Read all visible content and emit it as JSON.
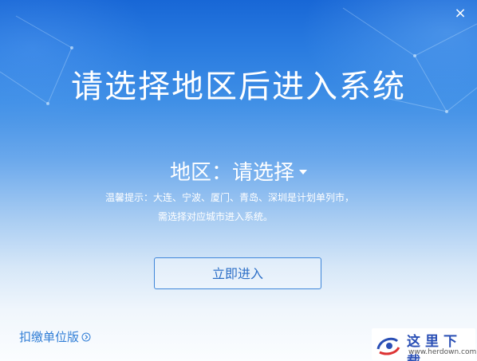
{
  "window": {
    "close_label": "×"
  },
  "main": {
    "title": "请选择地区后进入系统",
    "region_label": "地区：",
    "region_selected": "请选择",
    "hint_line1": "温馨提示：大连、宁波、厦门、青岛、深圳是计划单列市，",
    "hint_line2": "需选择对应城市进入系统。",
    "enter_button": "立即进入"
  },
  "footer": {
    "link_label": "扣缴单位版",
    "watermark_text": "这里下载",
    "watermark_url": "www.herdown.com"
  },
  "icons": {
    "close": "close-icon",
    "dropdown": "caret-down-icon",
    "link_arrow": "circle-arrow-right-icon",
    "watermark_logo": "watermark-logo-icon"
  },
  "colors": {
    "accent": "#2f7dd6",
    "button_text": "#2d6fc7",
    "button_border": "#3f86d9",
    "background_top": "#1867d6"
  }
}
